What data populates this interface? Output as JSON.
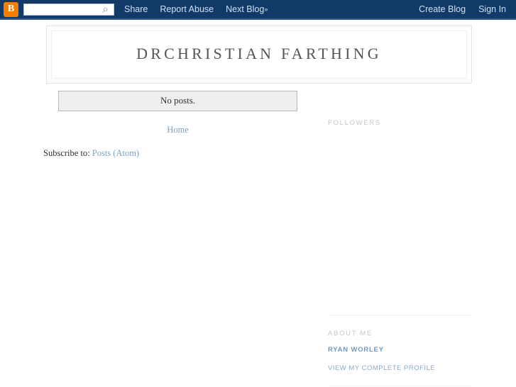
{
  "navbar": {
    "logo_icon": "blogger-b-icon",
    "logo_letter": "B",
    "search": {
      "value": "",
      "placeholder": "",
      "icon": "search-icon",
      "icon_glyph": "⌕"
    },
    "links_left": [
      {
        "label": "Share"
      },
      {
        "label": "Report Abuse"
      },
      {
        "label": "Next Blog",
        "suffix": "»"
      }
    ],
    "links_right": [
      {
        "label": "Create Blog"
      },
      {
        "label": "Sign In"
      }
    ],
    "background_color": "#123a68",
    "link_color": "#cfe0f2",
    "logo_color": "#f57d00"
  },
  "header": {
    "blog_title": "DRCHRISTIAN FARTHING"
  },
  "main": {
    "status_message": "No posts.",
    "pager": {
      "home_label": "Home"
    },
    "feed": {
      "prefix": "Subscribe to: ",
      "link_label": "Posts (Atom)"
    },
    "link_color": "#7ba2c7"
  },
  "sidebar": {
    "followers": {
      "title": "FOLLOWERS"
    },
    "about_me": {
      "title": "ABOUT ME",
      "profile_name": "RYAN WORLEY",
      "view_profile_label": "VIEW MY COMPLETE PROFILE"
    },
    "title_color": "#c6c6c6",
    "link_color": "#6e9ac4"
  }
}
